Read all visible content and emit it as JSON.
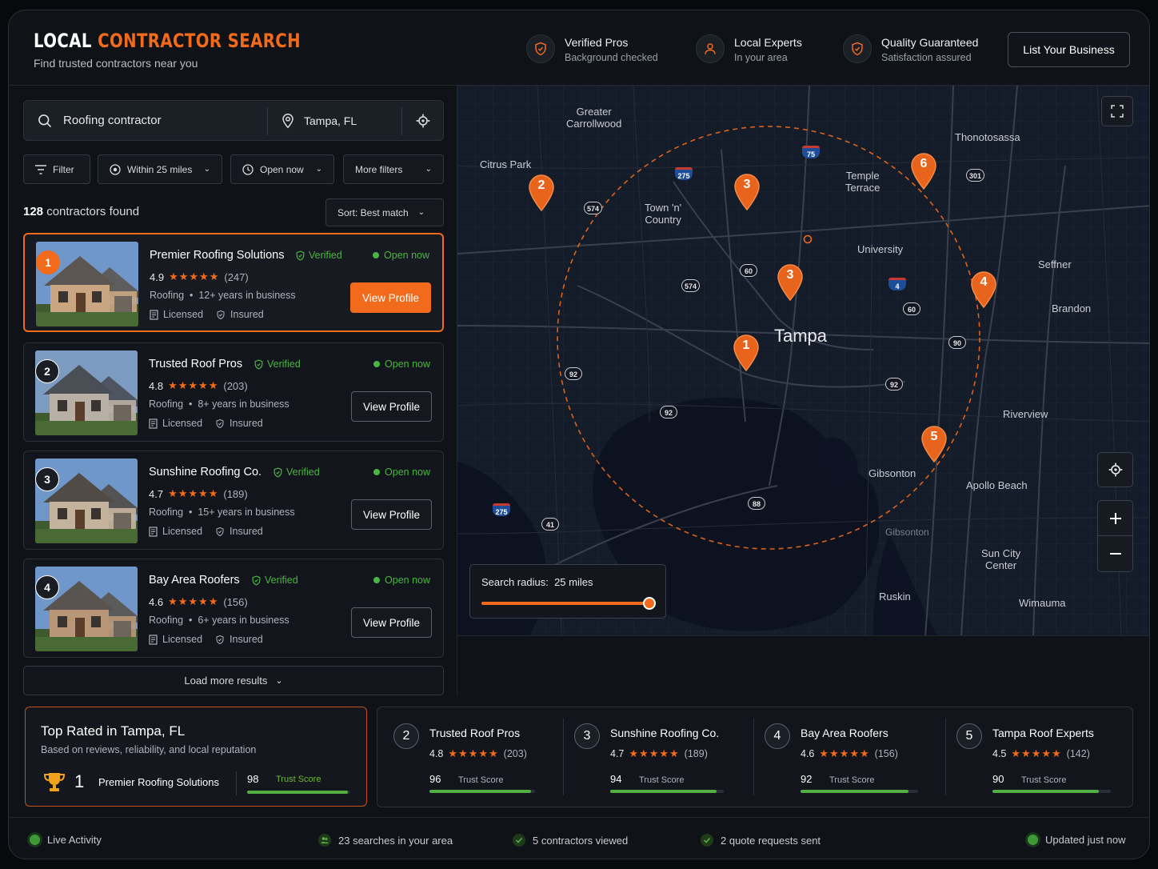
{
  "header": {
    "title_white": "LOCAL",
    "title_orange": "CONTRACTOR SEARCH",
    "subtitle": "Find trusted contractors near you",
    "badges": [
      {
        "title": "Verified Pros",
        "sub": "Background checked",
        "icon": "shield-check-icon"
      },
      {
        "title": "Local Experts",
        "sub": "In your area",
        "icon": "person-icon"
      },
      {
        "title": "Quality Guaranteed",
        "sub": "Satisfaction assured",
        "icon": "shield-check-icon"
      }
    ],
    "list_business": "List Your Business"
  },
  "search": {
    "query": "Roofing contractor",
    "location": "Tampa, FL"
  },
  "filters": {
    "filter": "Filter",
    "distance": "Within 25 miles",
    "open": "Open now",
    "more": "More filters"
  },
  "results": {
    "count": "128",
    "count_suffix": "contractors found",
    "sort": "Sort: Best match",
    "load_more": "Load more results",
    "items": [
      {
        "num": "1",
        "name": "Premier Roofing Solutions",
        "verified": "Verified",
        "open": "Open now",
        "rating": "4.9",
        "reviews": "(247)",
        "stars": "★★★★★",
        "meta": "Roofing  •  12+ years in business",
        "licensed": "Licensed",
        "insured": "Insured",
        "cta": "View Profile"
      },
      {
        "num": "2",
        "name": "Trusted Roof Pros",
        "verified": "Verified",
        "open": "Open now",
        "rating": "4.8",
        "reviews": "(203)",
        "stars": "★★★★★",
        "meta": "Roofing  •  8+ years in business",
        "licensed": "Licensed",
        "insured": "Insured",
        "cta": "View Profile"
      },
      {
        "num": "3",
        "name": "Sunshine Roofing Co.",
        "verified": "Verified",
        "open": "Open now",
        "rating": "4.7",
        "reviews": "(189)",
        "stars": "★★★★★",
        "meta": "Roofing  •  15+ years in business",
        "licensed": "Licensed",
        "insured": "Insured",
        "cta": "View Profile"
      },
      {
        "num": "4",
        "name": "Bay Area Roofers",
        "verified": "Verified",
        "open": "Open now",
        "rating": "4.6",
        "reviews": "(156)",
        "stars": "★★★★★",
        "meta": "Roofing  •  6+ years in business",
        "licensed": "Licensed",
        "insured": "Insured",
        "cta": "View Profile"
      }
    ]
  },
  "map": {
    "labels": {
      "greater_carrollwood": "Greater\nCarrollwood",
      "citrus_park": "Citrus Park",
      "town_n_country": "Town 'n'\nCountry",
      "temple_terrace": "Temple\nTerrace",
      "thonotosassa": "Thonotosassa",
      "university": "University",
      "seffner": "Seffner",
      "brandon": "Brandon",
      "tampa": "Tampa",
      "riverview": "Riverview",
      "gibsonton": "Gibsonton",
      "apollo_beach": "Apollo Beach",
      "gibsonton2": "Gibsonton",
      "sun_city_center": "Sun City\nCenter",
      "ruskin": "Ruskin",
      "wimauma": "Wimauma"
    },
    "highways": [
      "275",
      "75",
      "301",
      "574",
      "60",
      "4",
      "574",
      "60",
      "90",
      "92",
      "92",
      "92",
      "275",
      "41",
      "88"
    ],
    "pins": [
      "2",
      "3",
      "6",
      "3",
      "4",
      "1",
      "5"
    ],
    "radius_label": "Search radius:",
    "radius_value": "25 miles",
    "radius_fraction": 1.0
  },
  "top_rated": {
    "title": "Top Rated in Tampa, FL",
    "subtitle": "Based on reviews, reliability, and local reputation",
    "rank": "1",
    "name": "Premier Roofing Solutions",
    "score": "98",
    "score_label": "Trust Score",
    "score_value": 98,
    "others": [
      {
        "num": "2",
        "name": "Trusted Roof Pros",
        "rating": "4.8",
        "stars": "★★★★★",
        "reviews": "(203)",
        "score": "96",
        "score_label": "Trust Score",
        "score_value": 96
      },
      {
        "num": "3",
        "name": "Sunshine Roofing Co.",
        "rating": "4.7",
        "stars": "★★★★★",
        "reviews": "(189)",
        "score": "94",
        "score_label": "Trust Score",
        "score_value": 94
      },
      {
        "num": "4",
        "name": "Bay Area Roofers",
        "rating": "4.6",
        "stars": "★★★★★",
        "reviews": "(156)",
        "score": "92",
        "score_label": "Trust Score",
        "score_value": 92
      },
      {
        "num": "5",
        "name": "Tampa Roof Experts",
        "rating": "4.5",
        "stars": "★★★★★",
        "reviews": "(142)",
        "score": "90",
        "score_label": "Trust Score",
        "score_value": 90
      }
    ]
  },
  "status": {
    "live": "Live Activity",
    "searches": "23 searches in your area",
    "viewed": "5 contractors viewed",
    "quotes": "2 quote requests sent",
    "updated": "Updated just now"
  },
  "colors": {
    "accent": "#f26a1b",
    "success": "#4bb543",
    "background": "#0f1217"
  }
}
